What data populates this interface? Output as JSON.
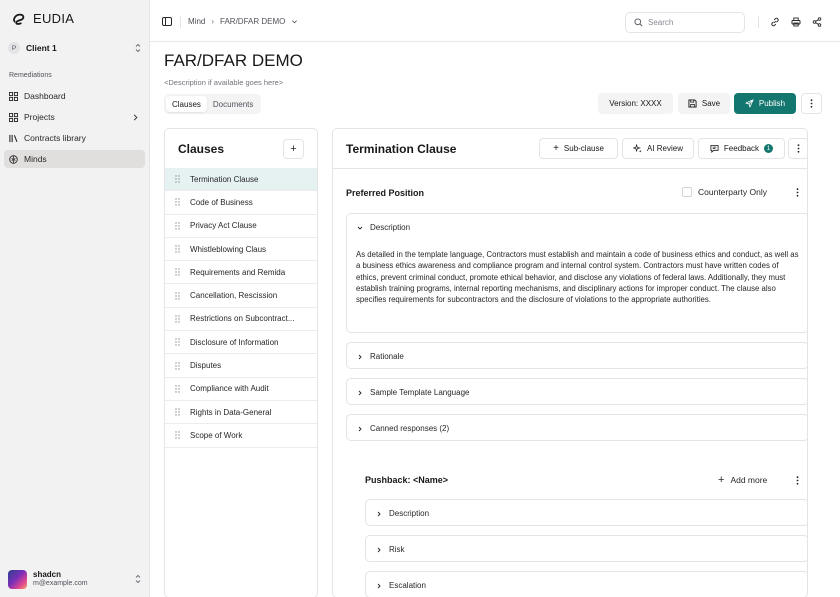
{
  "app": {
    "name": "EUDIA",
    "client": {
      "initial": "P",
      "name": "Client 1"
    },
    "section_label": "Remediations"
  },
  "sidebar": {
    "items": [
      {
        "label": "Dashboard",
        "icon": "grid-icon"
      },
      {
        "label": "Projects",
        "icon": "grid-icon"
      },
      {
        "label": "Contracts library",
        "icon": "library-icon"
      },
      {
        "label": "Minds",
        "icon": "brain-icon",
        "active": true
      }
    ]
  },
  "user": {
    "name": "shadcn",
    "email": "m@example.com"
  },
  "topbar": {
    "breadcrumb": [
      "Mind",
      "FAR/DFAR DEMO"
    ],
    "search_placeholder": "Search"
  },
  "page": {
    "title": "FAR/DFAR DEMO",
    "description": "<Description if available goes here>",
    "tabs": [
      "Clauses",
      "Documents"
    ],
    "active_tab": "Clauses",
    "version_label": "Version: XXXX",
    "save_label": "Save",
    "publish_label": "Publish"
  },
  "clauses": {
    "title": "Clauses",
    "items": [
      "Termination Clause",
      "Code of Business",
      "Privacy Act Clause",
      "Whistleblowing Claus",
      "Requirements and Remida",
      "Cancellation, Rescission",
      "Restrictions on Subcontract...",
      "Disclosure of Information",
      "Disputes",
      "Compliance with Audit",
      "Rights in Data-General",
      "Scope of Work"
    ],
    "active_index": 0
  },
  "detail": {
    "title": "Termination Clause",
    "subclause_label": "Sub-clause",
    "ai_review_label": "AI Review",
    "feedback_label": "Feedback",
    "feedback_count": "1",
    "preferred_position": "Preferred Position",
    "counterparty_only": "Counterparty Only",
    "description_label": "Description",
    "description_text": "As detailed in the template language, Contractors must establish and maintain a code of business ethics and conduct, as well as a business ethics awareness and compliance program and internal control system. Contractors must have written codes of ethics, prevent criminal conduct, promote ethical behavior, and disclose any violations of federal laws. Additionally, they must establish training programs, internal reporting mechanisms, and disciplinary actions for improper conduct. The clause also specifies requirements for subcontractors and the disclosure of violations to the appropriate authorities.",
    "rationale_label": "Rationale",
    "sample_label": "Sample Template Language",
    "canned_label": "Canned responses (2)",
    "pushback_title": "Pushback: <Name>",
    "add_more_label": "Add more",
    "pushback_sections": [
      "Description",
      "Risk",
      "Escalation"
    ]
  },
  "colors": {
    "accent": "#13776f",
    "active_clause_bg": "#e6f2f1",
    "sidebar_bg": "#f2f2f3"
  }
}
